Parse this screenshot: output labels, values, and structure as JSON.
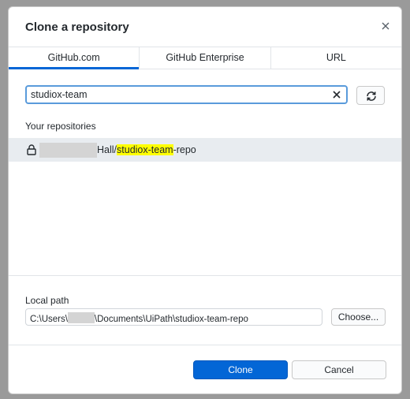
{
  "dialog": {
    "title": "Clone a repository",
    "close_icon": "close-icon"
  },
  "tabs": [
    {
      "label": "GitHub.com",
      "active": true
    },
    {
      "label": "GitHub Enterprise",
      "active": false
    },
    {
      "label": "URL",
      "active": false
    }
  ],
  "search": {
    "value": "studiox-team",
    "clear_icon": "clear-x-icon",
    "refresh_icon": "refresh-icon"
  },
  "repositories": {
    "section_label": "Your repositories",
    "items": [
      {
        "icon": "lock-icon",
        "name_prefix": "Hall/",
        "name_match": "studiox-team",
        "name_suffix": "-repo"
      }
    ]
  },
  "local_path": {
    "label": "Local path",
    "prefix": "C:\\Users\\",
    "suffix": "\\Documents\\UiPath\\studiox-team-repo",
    "choose_label": "Choose..."
  },
  "actions": {
    "clone_label": "Clone",
    "cancel_label": "Cancel"
  },
  "colors": {
    "accent": "#0366d6",
    "highlight": "#ffff00",
    "selected_row": "#e8ecf0"
  }
}
